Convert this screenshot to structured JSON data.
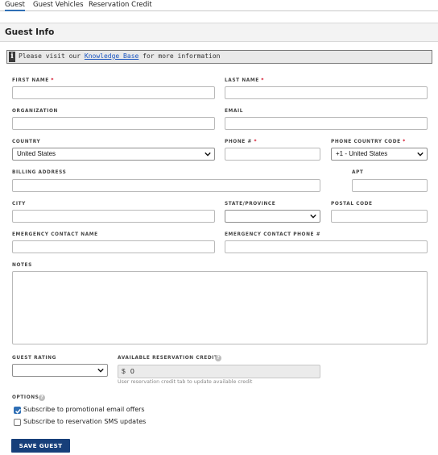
{
  "tabs": [
    {
      "label": "Guest",
      "active": true
    },
    {
      "label": "Guest Vehicles",
      "active": false
    },
    {
      "label": "Reservation Credit",
      "active": false
    }
  ],
  "section": {
    "title": "Guest Info"
  },
  "info": {
    "icon": "info-icon",
    "prefix": "Please visit our",
    "link": "Knowledge Base",
    "suffix": "for more information"
  },
  "fields": {
    "first_name": {
      "label": "FIRST NAME",
      "required": "*",
      "value": ""
    },
    "last_name": {
      "label": "LAST NAME",
      "required": "*",
      "value": ""
    },
    "organization": {
      "label": "ORGANIZATION",
      "value": ""
    },
    "email": {
      "label": "EMAIL",
      "value": ""
    },
    "country": {
      "label": "COUNTRY",
      "value": "United States"
    },
    "phone": {
      "label": "PHONE #",
      "required": "*",
      "value": ""
    },
    "phone_country_code": {
      "label": "PHONE COUNTRY CODE",
      "required": "*",
      "value": "+1 - United States"
    },
    "billing_address": {
      "label": "BILLING ADDRESS",
      "value": ""
    },
    "apt": {
      "label": "APT",
      "value": ""
    },
    "city": {
      "label": "CITY",
      "value": ""
    },
    "state": {
      "label": "STATE/PROVINCE",
      "value": ""
    },
    "postal_code": {
      "label": "POSTAL CODE",
      "value": ""
    },
    "emergency_contact_name": {
      "label": "EMERGENCY CONTACT NAME",
      "value": ""
    },
    "emergency_contact_phone": {
      "label": "EMERGENCY CONTACT PHONE #",
      "value": ""
    },
    "notes": {
      "label": "NOTES",
      "value": ""
    },
    "guest_rating": {
      "label": "GUEST RATING",
      "value": ""
    },
    "available_credit": {
      "label": "AVAILABLE RESERVATION CREDIT",
      "prefix": "$",
      "value": "0",
      "help": "User reservation credit tab to update available credit"
    }
  },
  "options": {
    "label": "OPTIONS",
    "items": [
      {
        "label": "Subscribe to promotional email offers",
        "checked": true
      },
      {
        "label": "Subscribe to reservation SMS updates",
        "checked": false
      }
    ]
  },
  "actions": {
    "save_label": "SAVE GUEST"
  },
  "colors": {
    "accent": "#2f6fb5",
    "button": "#173f7a",
    "required": "#d0021b",
    "link": "#1a55c0"
  }
}
